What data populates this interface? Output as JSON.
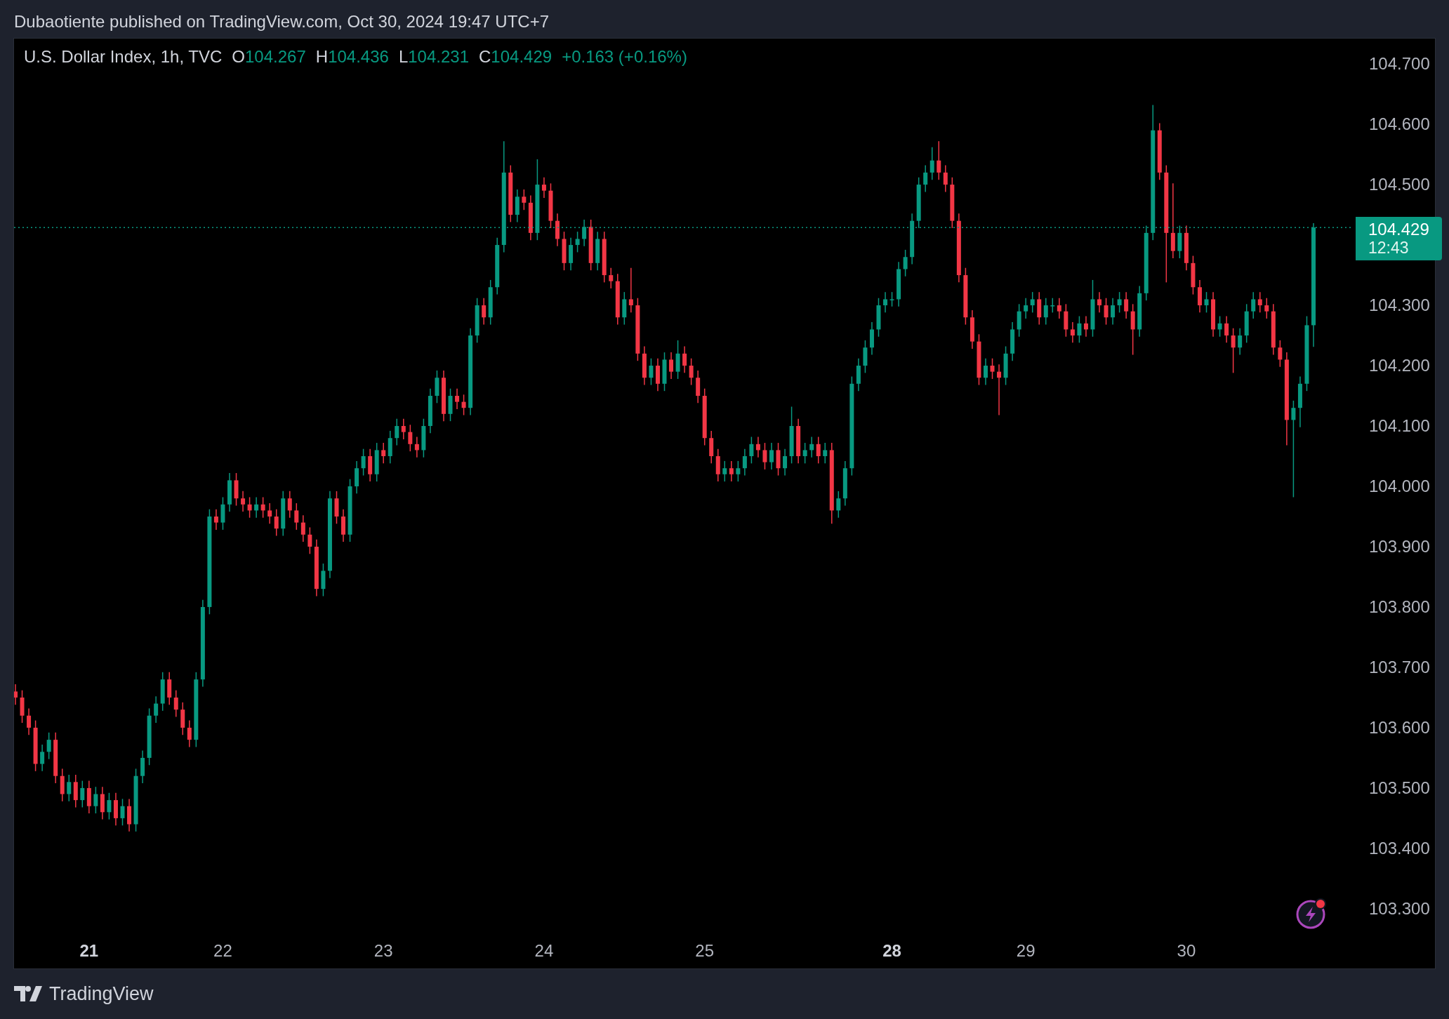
{
  "header": {
    "text": "Dubaotiente published on TradingView.com, Oct 30, 2024 19:47 UTC+7"
  },
  "chart": {
    "legend": {
      "symbol": "U.S. Dollar Index, 1h, TVC",
      "ohlc": [
        {
          "label": "O",
          "value": "104.267"
        },
        {
          "label": "H",
          "value": "104.436"
        },
        {
          "label": "L",
          "value": "104.231"
        },
        {
          "label": "C",
          "value": "104.429"
        }
      ],
      "change": "+0.163 (+0.16%)"
    },
    "chart_data": {
      "type": "candlestick",
      "ylim": [
        103.201,
        104.742
      ],
      "categories": [
        null,
        null,
        null,
        null,
        null,
        null,
        null,
        null,
        null,
        null,
        null,
        "21",
        null,
        null,
        null,
        null,
        null,
        null,
        null,
        null,
        null,
        null,
        null,
        null,
        null,
        null,
        null,
        null,
        null,
        null,
        null,
        "22",
        null,
        null,
        null,
        null,
        null,
        null,
        null,
        null,
        null,
        null,
        null,
        null,
        null,
        null,
        null,
        null,
        null,
        null,
        null,
        null,
        null,
        null,
        null,
        "23",
        null,
        null,
        null,
        null,
        null,
        null,
        null,
        null,
        null,
        null,
        null,
        null,
        null,
        null,
        null,
        null,
        null,
        null,
        null,
        null,
        null,
        null,
        null,
        "24",
        null,
        null,
        null,
        null,
        null,
        null,
        null,
        null,
        null,
        null,
        null,
        null,
        null,
        null,
        null,
        null,
        null,
        null,
        null,
        null,
        null,
        null,
        null,
        "25",
        null,
        null,
        null,
        null,
        null,
        null,
        null,
        null,
        null,
        null,
        null,
        null,
        null,
        null,
        null,
        null,
        null,
        null,
        null,
        null,
        null,
        null,
        null,
        null,
        null,
        null,
        null,
        "28",
        null,
        null,
        null,
        null,
        null,
        null,
        null,
        null,
        null,
        null,
        null,
        null,
        null,
        null,
        null,
        null,
        null,
        null,
        null,
        "29",
        null,
        null,
        null,
        null,
        null,
        null,
        null,
        null,
        null,
        null,
        null,
        null,
        null,
        null,
        null,
        null,
        null,
        null,
        null,
        null,
        null,
        null,
        null,
        "30",
        null,
        null,
        null,
        null,
        null,
        null,
        null,
        null,
        null,
        null,
        null,
        null,
        null,
        null,
        null,
        null,
        null,
        null,
        null
      ],
      "ref_lines": [
        {
          "axis": "y",
          "value": 104.429,
          "color": "#089981"
        }
      ],
      "yticks": [
        {
          "value": 104.7,
          "label": "104.700"
        },
        {
          "value": 104.6,
          "label": "104.600"
        },
        {
          "value": 104.5,
          "label": "104.500"
        },
        {
          "value": 104.3,
          "label": "104.300"
        },
        {
          "value": 104.2,
          "label": "104.200"
        },
        {
          "value": 104.1,
          "label": "104.100"
        },
        {
          "value": 104.0,
          "label": "104.000"
        },
        {
          "value": 103.9,
          "label": "103.900"
        },
        {
          "value": 103.8,
          "label": "103.800"
        },
        {
          "value": 103.7,
          "label": "103.700"
        },
        {
          "value": 103.6,
          "label": "103.600"
        },
        {
          "value": 103.5,
          "label": "103.500"
        },
        {
          "value": 103.4,
          "label": "103.400"
        },
        {
          "value": 103.3,
          "label": "103.300"
        }
      ],
      "ohlc": [
        [
          103.66,
          103.672,
          103.638,
          103.65
        ],
        [
          103.65,
          103.662,
          103.608,
          103.62
        ],
        [
          103.62,
          103.632,
          103.588,
          103.6
        ],
        [
          103.6,
          103.612,
          103.528,
          103.54
        ],
        [
          103.54,
          103.572,
          103.528,
          103.56
        ],
        [
          103.56,
          103.592,
          103.548,
          103.58
        ],
        [
          103.58,
          103.592,
          103.508,
          103.52
        ],
        [
          103.52,
          103.532,
          103.478,
          103.49
        ],
        [
          103.49,
          103.522,
          103.478,
          103.51
        ],
        [
          103.51,
          103.522,
          103.468,
          103.48
        ],
        [
          103.48,
          103.512,
          103.468,
          103.5
        ],
        [
          103.5,
          103.512,
          103.458,
          103.47
        ],
        [
          103.47,
          103.502,
          103.458,
          103.49
        ],
        [
          103.49,
          103.502,
          103.448,
          103.46
        ],
        [
          103.46,
          103.492,
          103.448,
          103.48
        ],
        [
          103.48,
          103.492,
          103.438,
          103.45
        ],
        [
          103.45,
          103.482,
          103.438,
          103.47
        ],
        [
          103.47,
          103.482,
          103.428,
          103.44
        ],
        [
          103.44,
          103.532,
          103.428,
          103.52
        ],
        [
          103.52,
          103.562,
          103.508,
          103.55
        ],
        [
          103.55,
          103.632,
          103.538,
          103.62
        ],
        [
          103.62,
          103.652,
          103.608,
          103.64
        ],
        [
          103.64,
          103.692,
          103.628,
          103.68
        ],
        [
          103.68,
          103.692,
          103.638,
          103.65
        ],
        [
          103.65,
          103.662,
          103.618,
          103.63
        ],
        [
          103.63,
          103.642,
          103.588,
          103.6
        ],
        [
          103.6,
          103.612,
          103.568,
          103.58
        ],
        [
          103.58,
          103.692,
          103.568,
          103.68
        ],
        [
          103.68,
          103.812,
          103.668,
          103.8
        ],
        [
          103.8,
          103.962,
          103.788,
          103.95
        ],
        [
          103.95,
          103.962,
          103.928,
          103.94
        ],
        [
          103.94,
          103.982,
          103.928,
          103.97
        ],
        [
          103.97,
          104.022,
          103.958,
          104.01
        ],
        [
          104.01,
          104.022,
          103.968,
          103.98
        ],
        [
          103.98,
          103.992,
          103.958,
          103.97
        ],
        [
          103.97,
          103.982,
          103.948,
          103.96
        ],
        [
          103.96,
          103.982,
          103.948,
          103.97
        ],
        [
          103.97,
          103.982,
          103.948,
          103.96
        ],
        [
          103.96,
          103.972,
          103.938,
          103.95
        ],
        [
          103.95,
          103.962,
          103.918,
          103.93
        ],
        [
          103.93,
          103.992,
          103.918,
          103.98
        ],
        [
          103.98,
          103.992,
          103.948,
          103.96
        ],
        [
          103.96,
          103.972,
          103.928,
          103.94
        ],
        [
          103.94,
          103.952,
          103.908,
          103.92
        ],
        [
          103.92,
          103.932,
          103.888,
          103.9
        ],
        [
          103.9,
          103.912,
          103.818,
          103.83
        ],
        [
          103.83,
          103.872,
          103.818,
          103.86
        ],
        [
          103.86,
          103.992,
          103.848,
          103.98
        ],
        [
          103.98,
          103.992,
          103.938,
          103.95
        ],
        [
          103.95,
          103.962,
          103.908,
          103.92
        ],
        [
          103.92,
          104.012,
          103.908,
          104
        ],
        [
          104,
          104.042,
          103.988,
          104.03
        ],
        [
          104.03,
          104.062,
          104.018,
          104.05
        ],
        [
          104.05,
          104.062,
          104.008,
          104.02
        ],
        [
          104.02,
          104.072,
          104.008,
          104.06
        ],
        [
          104.06,
          104.072,
          104.038,
          104.05
        ],
        [
          104.05,
          104.092,
          104.038,
          104.08
        ],
        [
          104.08,
          104.112,
          104.068,
          104.1
        ],
        [
          104.1,
          104.112,
          104.078,
          104.09
        ],
        [
          104.09,
          104.102,
          104.058,
          104.07
        ],
        [
          104.07,
          104.082,
          104.048,
          104.06
        ],
        [
          104.06,
          104.112,
          104.048,
          104.1
        ],
        [
          104.1,
          104.162,
          104.088,
          104.15
        ],
        [
          104.15,
          104.192,
          104.138,
          104.18
        ],
        [
          104.18,
          104.192,
          104.108,
          104.12
        ],
        [
          104.12,
          104.162,
          104.108,
          104.15
        ],
        [
          104.15,
          104.162,
          104.128,
          104.14
        ],
        [
          104.14,
          104.152,
          104.118,
          104.13
        ],
        [
          104.13,
          104.262,
          104.118,
          104.25
        ],
        [
          104.25,
          104.312,
          104.238,
          104.3
        ],
        [
          104.3,
          104.312,
          104.268,
          104.28
        ],
        [
          104.28,
          104.342,
          104.268,
          104.33
        ],
        [
          104.33,
          104.412,
          104.318,
          104.4
        ],
        [
          104.4,
          104.572,
          104.388,
          104.52
        ],
        [
          104.52,
          104.532,
          104.438,
          104.45
        ],
        [
          104.45,
          104.492,
          104.438,
          104.48
        ],
        [
          104.48,
          104.492,
          104.458,
          104.47
        ],
        [
          104.47,
          104.482,
          104.408,
          104.42
        ],
        [
          104.42,
          104.542,
          104.408,
          104.5
        ],
        [
          104.5,
          104.512,
          104.478,
          104.49
        ],
        [
          104.49,
          104.502,
          104.428,
          104.44
        ],
        [
          104.44,
          104.452,
          104.398,
          104.41
        ],
        [
          104.41,
          104.422,
          104.358,
          104.37
        ],
        [
          104.37,
          104.412,
          104.358,
          104.4
        ],
        [
          104.4,
          104.422,
          104.388,
          104.41
        ],
        [
          104.41,
          104.442,
          104.398,
          104.43
        ],
        [
          104.43,
          104.442,
          104.358,
          104.37
        ],
        [
          104.37,
          104.422,
          104.358,
          104.41
        ],
        [
          104.41,
          104.422,
          104.338,
          104.35
        ],
        [
          104.35,
          104.362,
          104.328,
          104.34
        ],
        [
          104.34,
          104.352,
          104.268,
          104.28
        ],
        [
          104.28,
          104.322,
          104.268,
          104.31
        ],
        [
          104.31,
          104.362,
          104.288,
          104.3
        ],
        [
          104.3,
          104.312,
          104.208,
          104.22
        ],
        [
          104.22,
          104.232,
          104.168,
          104.18
        ],
        [
          104.18,
          104.212,
          104.168,
          104.2
        ],
        [
          104.2,
          104.212,
          104.158,
          104.17
        ],
        [
          104.17,
          104.222,
          104.158,
          104.21
        ],
        [
          104.21,
          104.222,
          104.178,
          104.19
        ],
        [
          104.19,
          104.242,
          104.178,
          104.22
        ],
        [
          104.22,
          104.232,
          104.188,
          104.2
        ],
        [
          104.2,
          104.212,
          104.168,
          104.18
        ],
        [
          104.18,
          104.192,
          104.138,
          104.15
        ],
        [
          104.15,
          104.162,
          104.068,
          104.08
        ],
        [
          104.08,
          104.092,
          104.038,
          104.05
        ],
        [
          104.05,
          104.062,
          104.008,
          104.02
        ],
        [
          104.02,
          104.042,
          104.008,
          104.03
        ],
        [
          104.03,
          104.042,
          104.008,
          104.02
        ],
        [
          104.02,
          104.042,
          104.008,
          104.03
        ],
        [
          104.03,
          104.062,
          104.018,
          104.05
        ],
        [
          104.05,
          104.082,
          104.038,
          104.07
        ],
        [
          104.07,
          104.082,
          104.048,
          104.06
        ],
        [
          104.06,
          104.072,
          104.028,
          104.04
        ],
        [
          104.04,
          104.072,
          104.028,
          104.06
        ],
        [
          104.06,
          104.072,
          104.018,
          104.03
        ],
        [
          104.03,
          104.062,
          104.018,
          104.05
        ],
        [
          104.05,
          104.132,
          104.038,
          104.1
        ],
        [
          104.1,
          104.112,
          104.038,
          104.05
        ],
        [
          104.05,
          104.072,
          104.038,
          104.06
        ],
        [
          104.06,
          104.082,
          104.048,
          104.07
        ],
        [
          104.07,
          104.082,
          104.038,
          104.05
        ],
        [
          104.05,
          104.072,
          104.038,
          104.06
        ],
        [
          104.06,
          104.072,
          103.938,
          103.96
        ],
        [
          103.96,
          103.992,
          103.948,
          103.98
        ],
        [
          103.98,
          104.042,
          103.968,
          104.03
        ],
        [
          104.03,
          104.182,
          104.018,
          104.17
        ],
        [
          104.17,
          104.212,
          104.158,
          104.2
        ],
        [
          104.2,
          104.242,
          104.188,
          104.23
        ],
        [
          104.23,
          104.272,
          104.218,
          104.26
        ],
        [
          104.26,
          104.312,
          104.248,
          104.3
        ],
        [
          104.3,
          104.322,
          104.288,
          104.31
        ],
        [
          104.31,
          104.322,
          104.298,
          104.31
        ],
        [
          104.31,
          104.372,
          104.298,
          104.36
        ],
        [
          104.36,
          104.392,
          104.348,
          104.38
        ],
        [
          104.38,
          104.452,
          104.368,
          104.44
        ],
        [
          104.44,
          104.512,
          104.428,
          104.5
        ],
        [
          104.5,
          104.532,
          104.488,
          104.52
        ],
        [
          104.52,
          104.562,
          104.508,
          104.54
        ],
        [
          104.54,
          104.572,
          104.508,
          104.52
        ],
        [
          104.52,
          104.532,
          104.488,
          104.5
        ],
        [
          104.5,
          104.512,
          104.428,
          104.44
        ],
        [
          104.44,
          104.452,
          104.338,
          104.35
        ],
        [
          104.35,
          104.362,
          104.268,
          104.28
        ],
        [
          104.28,
          104.292,
          104.228,
          104.24
        ],
        [
          104.24,
          104.252,
          104.168,
          104.18
        ],
        [
          104.18,
          104.212,
          104.168,
          104.2
        ],
        [
          104.2,
          104.212,
          104.178,
          104.19
        ],
        [
          104.19,
          104.202,
          104.118,
          104.18
        ],
        [
          104.18,
          104.232,
          104.168,
          104.22
        ],
        [
          104.22,
          104.272,
          104.208,
          104.26
        ],
        [
          104.26,
          104.302,
          104.248,
          104.29
        ],
        [
          104.29,
          104.312,
          104.278,
          104.3
        ],
        [
          104.3,
          104.322,
          104.288,
          104.31
        ],
        [
          104.31,
          104.322,
          104.268,
          104.28
        ],
        [
          104.28,
          104.312,
          104.268,
          104.3
        ],
        [
          104.3,
          104.312,
          104.288,
          104.3
        ],
        [
          104.3,
          104.312,
          104.278,
          104.29
        ],
        [
          104.29,
          104.302,
          104.248,
          104.26
        ],
        [
          104.26,
          104.272,
          104.238,
          104.25
        ],
        [
          104.25,
          104.282,
          104.238,
          104.27
        ],
        [
          104.27,
          104.282,
          104.248,
          104.26
        ],
        [
          104.26,
          104.342,
          104.248,
          104.31
        ],
        [
          104.31,
          104.322,
          104.288,
          104.3
        ],
        [
          104.3,
          104.312,
          104.268,
          104.28
        ],
        [
          104.28,
          104.312,
          104.268,
          104.3
        ],
        [
          104.3,
          104.322,
          104.288,
          104.31
        ],
        [
          104.31,
          104.322,
          104.278,
          104.29
        ],
        [
          104.29,
          104.302,
          104.218,
          104.26
        ],
        [
          104.26,
          104.332,
          104.248,
          104.32
        ],
        [
          104.32,
          104.432,
          104.308,
          104.42
        ],
        [
          104.42,
          104.632,
          104.408,
          104.59
        ],
        [
          104.59,
          104.602,
          104.508,
          104.52
        ],
        [
          104.52,
          104.532,
          104.338,
          104.42
        ],
        [
          104.42,
          104.502,
          104.378,
          104.39
        ],
        [
          104.39,
          104.432,
          104.378,
          104.42
        ],
        [
          104.42,
          104.432,
          104.358,
          104.37
        ],
        [
          104.37,
          104.382,
          104.318,
          104.33
        ],
        [
          104.33,
          104.342,
          104.288,
          104.3
        ],
        [
          104.3,
          104.322,
          104.288,
          104.31
        ],
        [
          104.31,
          104.322,
          104.248,
          104.26
        ],
        [
          104.26,
          104.282,
          104.248,
          104.27
        ],
        [
          104.27,
          104.282,
          104.238,
          104.25
        ],
        [
          104.25,
          104.262,
          104.188,
          104.23
        ],
        [
          104.23,
          104.262,
          104.218,
          104.25
        ],
        [
          104.25,
          104.302,
          104.238,
          104.29
        ],
        [
          104.29,
          104.322,
          104.278,
          104.31
        ],
        [
          104.31,
          104.322,
          104.288,
          104.3
        ],
        [
          104.3,
          104.312,
          104.278,
          104.29
        ],
        [
          104.29,
          104.302,
          104.218,
          104.23
        ],
        [
          104.23,
          104.242,
          104.198,
          104.21
        ],
        [
          104.21,
          104.222,
          104.068,
          104.11
        ],
        [
          104.11,
          104.142,
          103.982,
          104.13
        ],
        [
          104.13,
          104.182,
          104.098,
          104.17
        ],
        [
          104.17,
          104.282,
          104.158,
          104.267
        ],
        [
          104.267,
          104.436,
          104.231,
          104.429
        ]
      ]
    },
    "xtick_styles": [
      {
        "emphasized": true
      },
      {
        "emphasized": false
      },
      {
        "emphasized": false
      },
      {
        "emphasized": false
      },
      {
        "emphasized": false
      },
      {
        "emphasized": true
      },
      {
        "emphasized": false
      },
      {
        "emphasized": false
      }
    ],
    "last_price": {
      "price": "104.429",
      "countdown": "12:43"
    }
  },
  "footer": {
    "brand": "TradingView"
  }
}
